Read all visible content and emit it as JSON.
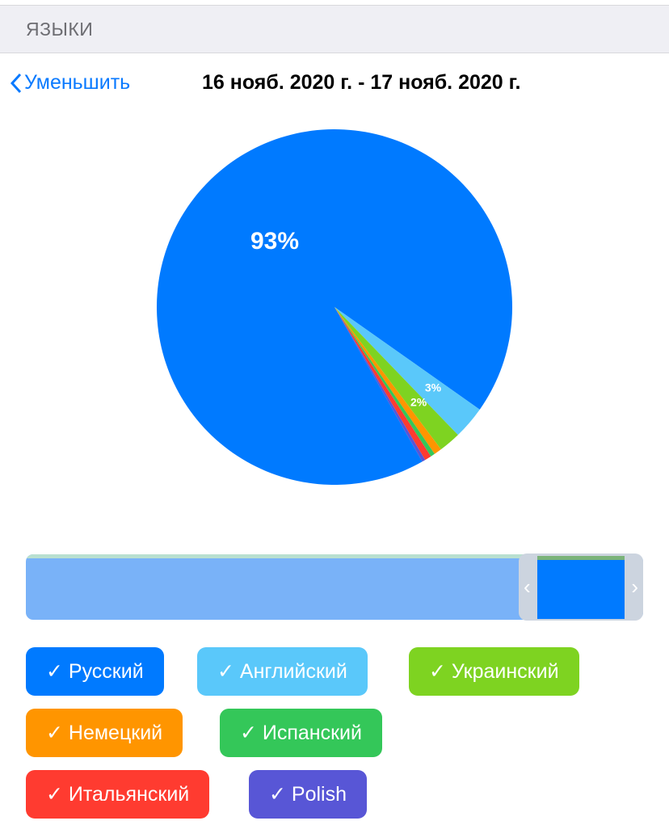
{
  "section_header": "ЯЗЫКИ",
  "nav": {
    "back_label": "Уменьшить",
    "date_range": "16 нояб. 2020 г. - 17 нояб. 2020 г."
  },
  "chart_data": {
    "type": "pie",
    "slices": [
      {
        "name": "Русский",
        "value": 93,
        "color": "#007aff",
        "label": "93%"
      },
      {
        "name": "Английский",
        "value": 3,
        "color": "#5ac8fa",
        "label": "3%"
      },
      {
        "name": "Украинский",
        "value": 2,
        "color": "#7ed321",
        "label": "2%"
      },
      {
        "name": "Немецкий",
        "value": 0.7,
        "color": "#ff9500",
        "label": ""
      },
      {
        "name": "Испанский",
        "value": 0.4,
        "color": "#34c759",
        "label": ""
      },
      {
        "name": "Итальянский",
        "value": 0.6,
        "color": "#ff3b30",
        "label": ""
      },
      {
        "name": "Polish",
        "value": 0.3,
        "color": "#5856d6",
        "label": ""
      }
    ]
  },
  "slider": {
    "left_arrow": "‹",
    "right_arrow": "›"
  },
  "filters": [
    {
      "label": "✓ Русский",
      "color": "#007aff"
    },
    {
      "label": "✓ Английский",
      "color": "#5ac8fa"
    },
    {
      "label": "✓ Украинский",
      "color": "#7ed321"
    },
    {
      "label": "✓ Немецкий",
      "color": "#ff9500"
    },
    {
      "label": "✓ Испанский",
      "color": "#34c759"
    },
    {
      "label": "✓ Итальянский",
      "color": "#ff3b30"
    },
    {
      "label": "✓ Polish",
      "color": "#5856d6"
    }
  ]
}
